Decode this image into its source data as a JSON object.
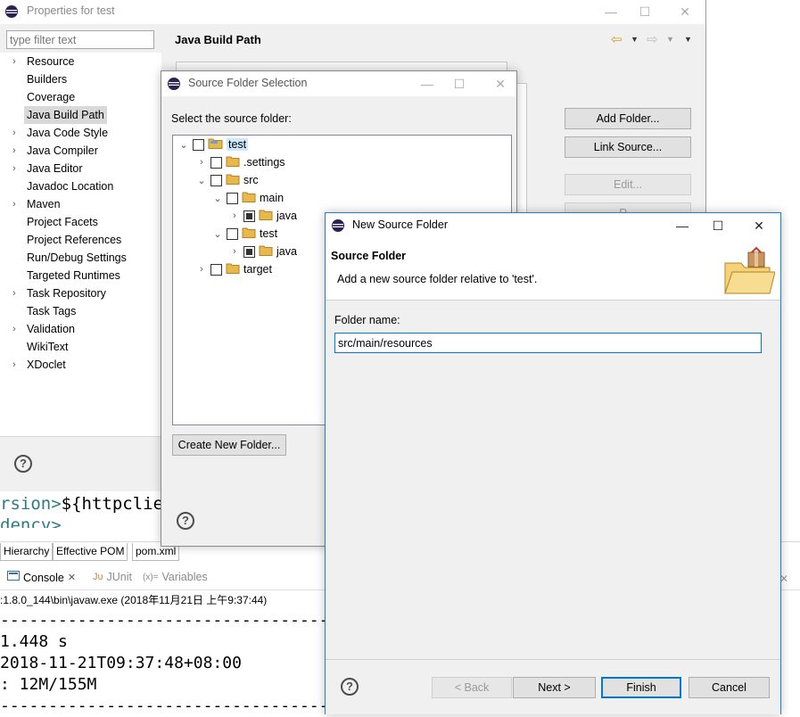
{
  "editor": {
    "line1_tag": "rsion>",
    "line1_text": "${httpclie",
    "line2_text": "dency>"
  },
  "pom_tabs": [
    "Hierarchy",
    "Effective POM",
    "pom.xml"
  ],
  "console": {
    "tabs": [
      {
        "label": "Console",
        "close": "✕"
      },
      {
        "label": "JUnit",
        "prefix": "Jᴜ"
      },
      {
        "label": "Variables",
        "prefix": "(x)="
      }
    ],
    "path": ":1.8.0_144\\bin\\javaw.exe (2018年11月21日 上午9:37:44)",
    "lines": [
      "-----------------------------------",
      "1.448 s",
      " 2018-11-21T09:37:48+08:00",
      ": 12M/155M",
      "-----------------------------------"
    ]
  },
  "properties": {
    "title": "Properties for test",
    "filter_placeholder": "type filter text",
    "tree": [
      {
        "label": "Resource",
        "chevron": true
      },
      {
        "label": "Builders",
        "chevron": false
      },
      {
        "label": "Coverage",
        "chevron": false
      },
      {
        "label": "Java Build Path",
        "chevron": false,
        "selected": true
      },
      {
        "label": "Java Code Style",
        "chevron": true
      },
      {
        "label": "Java Compiler",
        "chevron": true
      },
      {
        "label": "Java Editor",
        "chevron": true
      },
      {
        "label": "Javadoc Location",
        "chevron": false
      },
      {
        "label": "Maven",
        "chevron": true
      },
      {
        "label": "Project Facets",
        "chevron": false
      },
      {
        "label": "Project References",
        "chevron": false
      },
      {
        "label": "Run/Debug Settings",
        "chevron": false
      },
      {
        "label": "Targeted Runtimes",
        "chevron": false
      },
      {
        "label": "Task Repository",
        "chevron": true
      },
      {
        "label": "Task Tags",
        "chevron": false
      },
      {
        "label": "Validation",
        "chevron": true
      },
      {
        "label": "WikiText",
        "chevron": false
      },
      {
        "label": "XDoclet",
        "chevron": true
      }
    ],
    "page_title": "Java Build Path",
    "buttons": {
      "add_folder": "Add Folder...",
      "link_source": "Link Source...",
      "edit": "Edit...",
      "remove": "R..."
    }
  },
  "source_folder_selection": {
    "title": "Source Folder Selection",
    "label": "Select the source folder:",
    "tree": [
      {
        "label": "test",
        "indent": 0,
        "chevron": "open",
        "checkbox": "empty",
        "selected": true
      },
      {
        "label": ".settings",
        "indent": 1,
        "chevron": "closed",
        "checkbox": "empty"
      },
      {
        "label": "src",
        "indent": 1,
        "chevron": "open",
        "checkbox": "empty"
      },
      {
        "label": "main",
        "indent": 2,
        "chevron": "open",
        "checkbox": "empty"
      },
      {
        "label": "java",
        "indent": 3,
        "chevron": "closed",
        "checkbox": "partial"
      },
      {
        "label": "test",
        "indent": 2,
        "chevron": "open",
        "checkbox": "empty"
      },
      {
        "label": "java",
        "indent": 3,
        "chevron": "closed",
        "checkbox": "partial"
      },
      {
        "label": "target",
        "indent": 1,
        "chevron": "closed",
        "checkbox": "empty"
      }
    ],
    "create_button": "Create New Folder..."
  },
  "new_source_folder": {
    "title": "New Source Folder",
    "heading": "Source Folder",
    "description": "Add a new source folder relative to 'test'.",
    "folder_label": "Folder name:",
    "folder_value": "src/main/resources",
    "buttons": {
      "back": "< Back",
      "next": "Next >",
      "finish": "Finish",
      "cancel": "Cancel"
    }
  },
  "colors": {
    "accent": "#0078d7",
    "folder_yellow": "#e8b84a",
    "selection": "#cce8ff"
  }
}
